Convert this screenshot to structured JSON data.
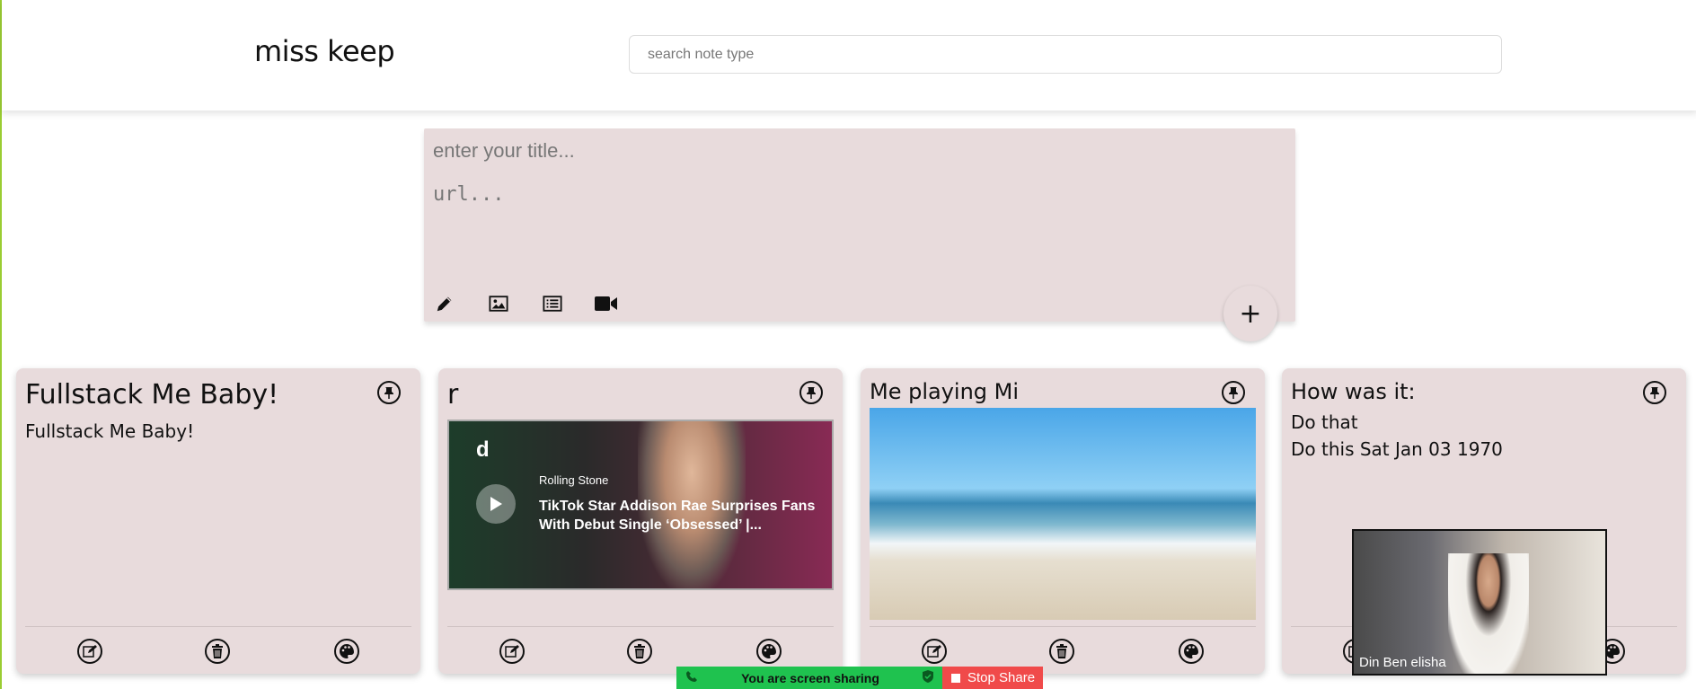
{
  "app": {
    "title": "miss keep"
  },
  "search": {
    "placeholder": "search note type"
  },
  "composer": {
    "title_placeholder": "enter your title...",
    "url_placeholder": "url...",
    "tools": [
      "pencil-icon",
      "image-icon",
      "list-icon",
      "video-camera-icon"
    ],
    "add_label": "+"
  },
  "notes": [
    {
      "title": "Fullstack Me Baby!",
      "body": "Fullstack Me Baby!",
      "type": "text"
    },
    {
      "title": "r",
      "type": "video",
      "video": {
        "channel_letter": "d",
        "source": "Rolling Stone",
        "title": "TikTok Star Addison Rae Surprises Fans With Debut Single ‘Obsessed’ |..."
      }
    },
    {
      "title": "Me playing Mi",
      "type": "image"
    },
    {
      "title": "How was it:",
      "type": "todo",
      "todos": [
        "Do that",
        "Do this Sat Jan 03 1970"
      ]
    }
  ],
  "note_actions": [
    "edit-icon",
    "trash-icon",
    "palette-icon"
  ],
  "video_call": {
    "name": "Din Ben elisha"
  },
  "screen_share": {
    "status": "You are screen sharing",
    "stop_label": "Stop Share"
  },
  "colors": {
    "card_bg": "#e8dbdc",
    "share_green": "#1fc24f",
    "share_red": "#f04a4a"
  }
}
